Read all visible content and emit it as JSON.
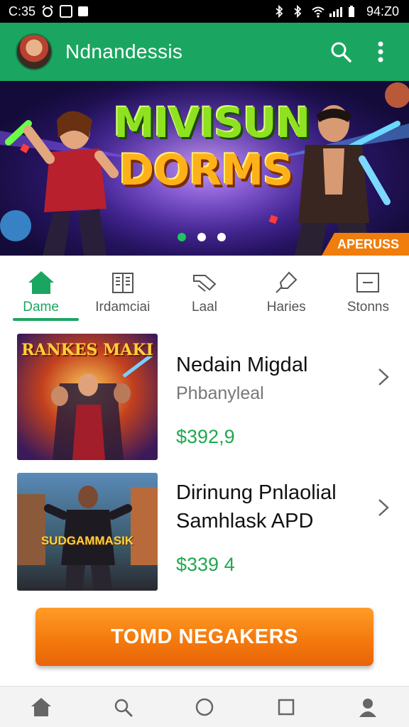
{
  "status_bar": {
    "time_left": "C:35",
    "time_right": "94:Z0"
  },
  "app_bar": {
    "title": "Ndnandessis",
    "icons": [
      "avatar",
      "search-icon",
      "more-vert-icon"
    ]
  },
  "banner": {
    "title_line1": "VISUN",
    "title_line1_prefix": "MI",
    "title_line2": "DORMS",
    "badge": "APERUSS",
    "slide_count": 3,
    "active_slide": 1
  },
  "tabs": [
    {
      "label": "Dame",
      "icon": "home-icon",
      "active": true
    },
    {
      "label": "Irdamciai",
      "icon": "book-icon",
      "active": false
    },
    {
      "label": "Laal",
      "icon": "tag-icon",
      "active": false
    },
    {
      "label": "Haries",
      "icon": "pin-icon",
      "active": false
    },
    {
      "label": "Stonns",
      "icon": "card-icon",
      "active": false
    }
  ],
  "items": [
    {
      "title": "Nedain Migdal",
      "subtitle": "Phbanyleal",
      "price": "$392,9",
      "thumb_text": "RANKES MAKI"
    },
    {
      "title_line1": "Dirinung Pnlaolial",
      "title_line2": "Samhlask APD",
      "price": "$339 4",
      "thumb_text": "SUDGAMMASIK"
    }
  ],
  "cta": {
    "label": "TOMD NEGAKERS"
  },
  "nav": [
    "home-icon",
    "search-icon",
    "circle-icon",
    "square-icon",
    "person-icon"
  ],
  "colors": {
    "primary": "#1aa660",
    "accent": "#f47a0d",
    "price": "#20a84f"
  }
}
